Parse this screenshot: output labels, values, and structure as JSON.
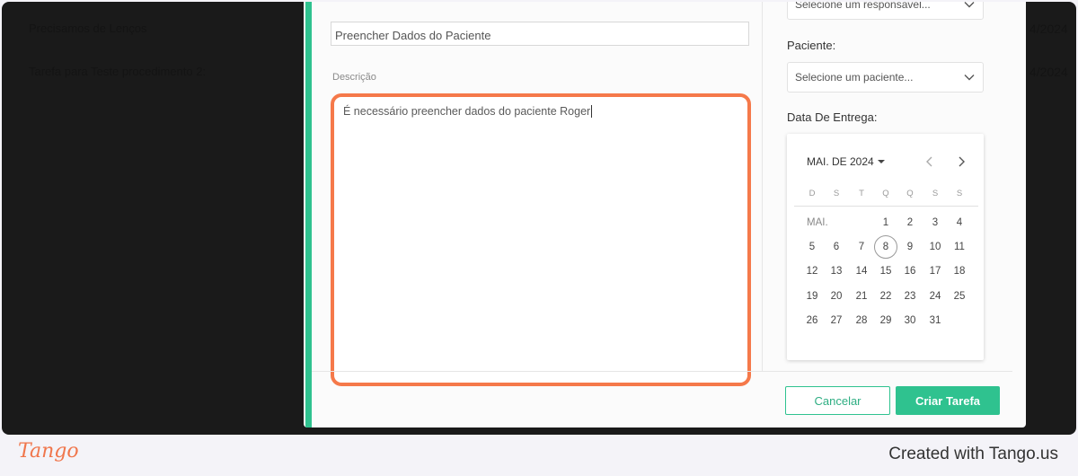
{
  "background": {
    "rows": [
      {
        "title": "Precisamos de Lenços",
        "date_fragment": "4/2024"
      },
      {
        "title": "Tarefa para Teste procedimento 2:",
        "date_fragment": "4/2024"
      }
    ]
  },
  "form": {
    "title_value": "Preencher Dados do Paciente",
    "description_label": "Descrição",
    "description_value": "É necessário preencher dados do paciente Roger",
    "responsavel_placeholder": "Selecione um responsável...",
    "paciente_label": "Paciente:",
    "paciente_placeholder": "Selecione um paciente...",
    "data_label": "Data De Entrega:"
  },
  "calendar": {
    "month_label": "MAI. DE 2024",
    "month_short": "MAI.",
    "weekdays": [
      "D",
      "S",
      "T",
      "Q",
      "Q",
      "S",
      "S"
    ],
    "weeks": [
      [
        "",
        "",
        "",
        "1",
        "2",
        "3",
        "4"
      ],
      [
        "5",
        "6",
        "7",
        "8",
        "9",
        "10",
        "11"
      ],
      [
        "12",
        "13",
        "14",
        "15",
        "16",
        "17",
        "18"
      ],
      [
        "19",
        "20",
        "21",
        "22",
        "23",
        "24",
        "25"
      ],
      [
        "26",
        "27",
        "28",
        "29",
        "30",
        "31",
        ""
      ]
    ],
    "selected_day": "8"
  },
  "buttons": {
    "cancel": "Cancelar",
    "create": "Criar Tarefa"
  },
  "footer": {
    "logo": "Tango",
    "credit": "Created with Tango.us"
  },
  "colors": {
    "accent_green": "#2fc28f",
    "highlight_orange": "#f5794a"
  }
}
